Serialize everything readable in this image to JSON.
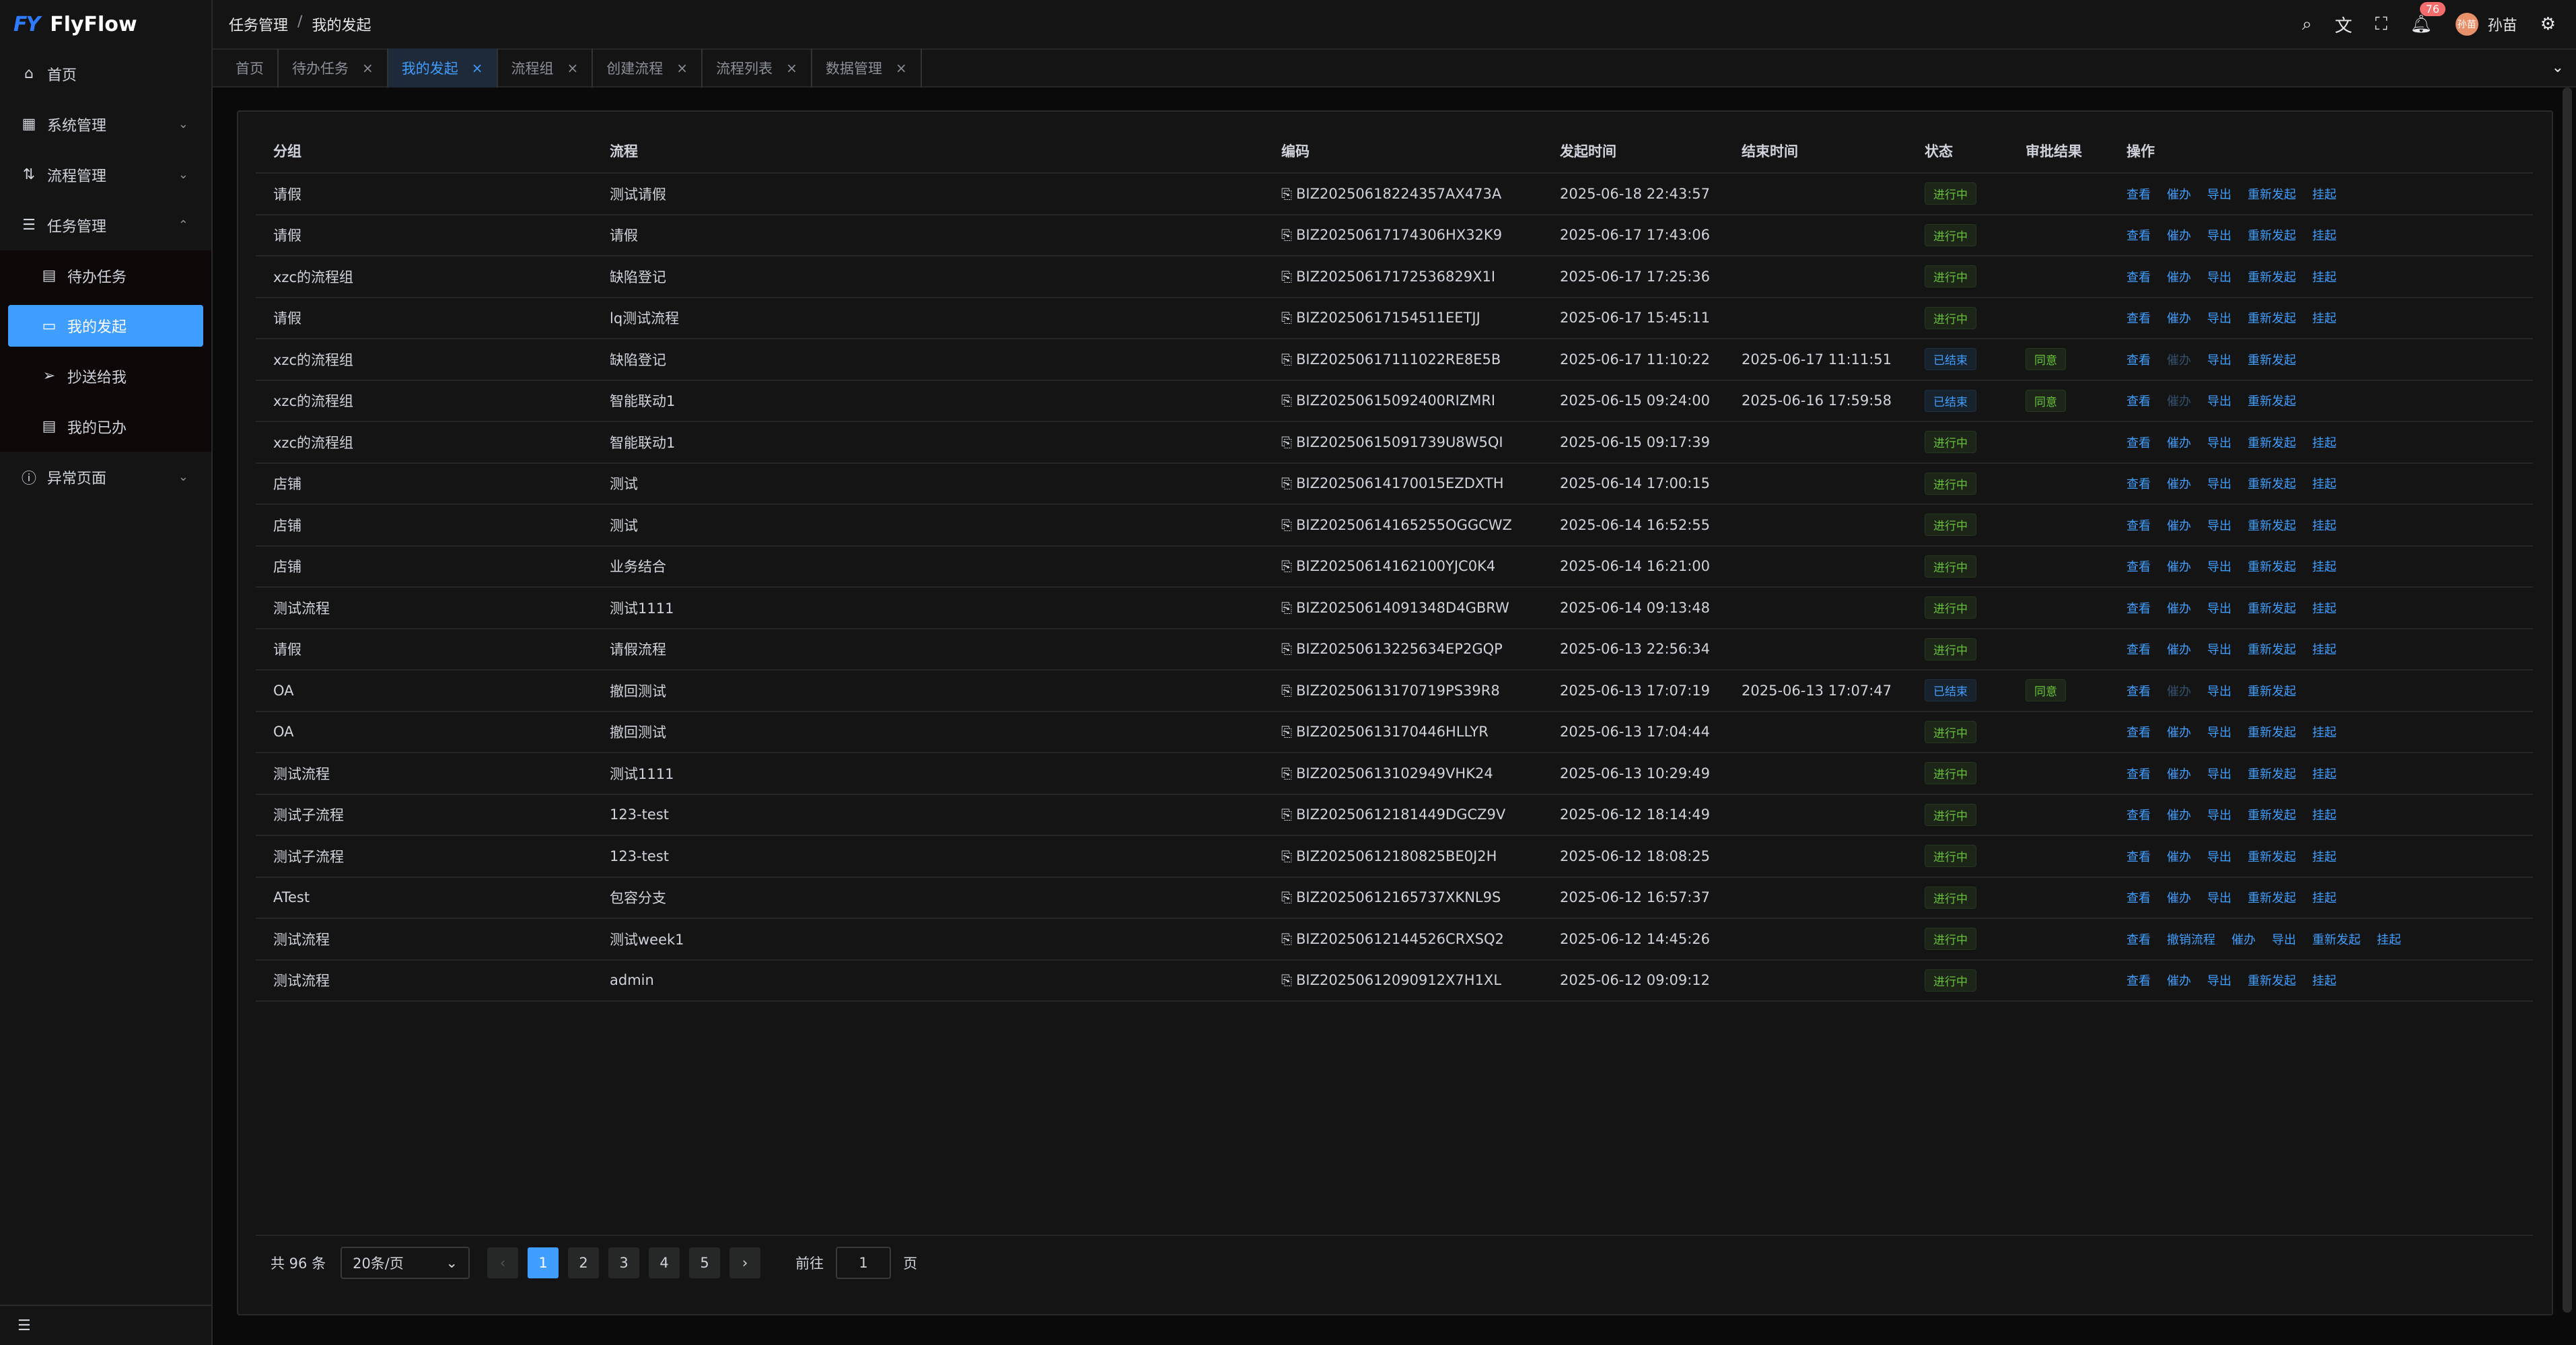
{
  "app": {
    "logo_mark": "FY",
    "name": "FlyFlow"
  },
  "sidebar": {
    "items": [
      {
        "label": "首页"
      },
      {
        "label": "系统管理"
      },
      {
        "label": "流程管理"
      },
      {
        "label": "任务管理"
      },
      {
        "label": "异常页面"
      }
    ],
    "task_sub": [
      {
        "label": "待办任务"
      },
      {
        "label": "我的发起"
      },
      {
        "label": "抄送给我"
      },
      {
        "label": "我的已办"
      }
    ]
  },
  "header": {
    "breadcrumb": [
      "任务管理",
      "我的发起"
    ],
    "notification_count": "76",
    "user_name": "孙苗",
    "avatar_text": "孙苗"
  },
  "tabs": [
    {
      "label": "首页",
      "closable": false
    },
    {
      "label": "待办任务",
      "closable": true
    },
    {
      "label": "我的发起",
      "closable": true,
      "active": true
    },
    {
      "label": "流程组",
      "closable": true
    },
    {
      "label": "创建流程",
      "closable": true
    },
    {
      "label": "流程列表",
      "closable": true
    },
    {
      "label": "数据管理",
      "closable": true
    }
  ],
  "table": {
    "columns": [
      "分组",
      "流程",
      "编码",
      "发起时间",
      "结束时间",
      "状态",
      "审批结果",
      "操作"
    ],
    "rows": [
      {
        "group": "请假",
        "flow": "测试请假",
        "code": "BIZ20250618224357AX473A",
        "start": "2025-06-18 22:43:57",
        "end": "",
        "status": "进行中",
        "result": "",
        "ops": [
          "查看",
          "催办",
          "导出",
          "重新发起",
          "挂起"
        ]
      },
      {
        "group": "请假",
        "flow": "请假",
        "code": "BIZ20250617174306HX32K9",
        "start": "2025-06-17 17:43:06",
        "end": "",
        "status": "进行中",
        "result": "",
        "ops": [
          "查看",
          "催办",
          "导出",
          "重新发起",
          "挂起"
        ]
      },
      {
        "group": "xzc的流程组",
        "flow": "缺陷登记",
        "code": "BIZ20250617172536829X1I",
        "start": "2025-06-17 17:25:36",
        "end": "",
        "status": "进行中",
        "result": "",
        "ops": [
          "查看",
          "催办",
          "导出",
          "重新发起",
          "挂起"
        ]
      },
      {
        "group": "请假",
        "flow": "lq测试流程",
        "code": "BIZ20250617154511EETJJ",
        "start": "2025-06-17 15:45:11",
        "end": "",
        "status": "进行中",
        "result": "",
        "ops": [
          "查看",
          "催办",
          "导出",
          "重新发起",
          "挂起"
        ]
      },
      {
        "group": "xzc的流程组",
        "flow": "缺陷登记",
        "code": "BIZ20250617111022RE8E5B",
        "start": "2025-06-17 11:10:22",
        "end": "2025-06-17 11:11:51",
        "status": "已结束",
        "result": "同意",
        "ops": [
          "查看",
          "催办",
          "导出",
          "重新发起"
        ]
      },
      {
        "group": "xzc的流程组",
        "flow": "智能联动1",
        "code": "BIZ20250615092400RIZMRI",
        "start": "2025-06-15 09:24:00",
        "end": "2025-06-16 17:59:58",
        "status": "已结束",
        "result": "同意",
        "ops": [
          "查看",
          "催办",
          "导出",
          "重新发起"
        ]
      },
      {
        "group": "xzc的流程组",
        "flow": "智能联动1",
        "code": "BIZ20250615091739U8W5QI",
        "start": "2025-06-15 09:17:39",
        "end": "",
        "status": "进行中",
        "result": "",
        "ops": [
          "查看",
          "催办",
          "导出",
          "重新发起",
          "挂起"
        ]
      },
      {
        "group": "店铺",
        "flow": "测试",
        "code": "BIZ20250614170015EZDXTH",
        "start": "2025-06-14 17:00:15",
        "end": "",
        "status": "进行中",
        "result": "",
        "ops": [
          "查看",
          "催办",
          "导出",
          "重新发起",
          "挂起"
        ]
      },
      {
        "group": "店铺",
        "flow": "测试",
        "code": "BIZ20250614165255OGGCWZ",
        "start": "2025-06-14 16:52:55",
        "end": "",
        "status": "进行中",
        "result": "",
        "ops": [
          "查看",
          "催办",
          "导出",
          "重新发起",
          "挂起"
        ]
      },
      {
        "group": "店铺",
        "flow": "业务结合",
        "code": "BIZ20250614162100YJC0K4",
        "start": "2025-06-14 16:21:00",
        "end": "",
        "status": "进行中",
        "result": "",
        "ops": [
          "查看",
          "催办",
          "导出",
          "重新发起",
          "挂起"
        ]
      },
      {
        "group": "测试流程",
        "flow": "测试1111",
        "code": "BIZ20250614091348D4GBRW",
        "start": "2025-06-14 09:13:48",
        "end": "",
        "status": "进行中",
        "result": "",
        "ops": [
          "查看",
          "催办",
          "导出",
          "重新发起",
          "挂起"
        ]
      },
      {
        "group": "请假",
        "flow": "请假流程",
        "code": "BIZ20250613225634EP2GQP",
        "start": "2025-06-13 22:56:34",
        "end": "",
        "status": "进行中",
        "result": "",
        "ops": [
          "查看",
          "催办",
          "导出",
          "重新发起",
          "挂起"
        ]
      },
      {
        "group": "OA",
        "flow": "撤回测试",
        "code": "BIZ20250613170719PS39R8",
        "start": "2025-06-13 17:07:19",
        "end": "2025-06-13 17:07:47",
        "status": "已结束",
        "result": "同意",
        "ops": [
          "查看",
          "催办",
          "导出",
          "重新发起"
        ]
      },
      {
        "group": "OA",
        "flow": "撤回测试",
        "code": "BIZ20250613170446HLLYR",
        "start": "2025-06-13 17:04:44",
        "end": "",
        "status": "进行中",
        "result": "",
        "ops": [
          "查看",
          "催办",
          "导出",
          "重新发起",
          "挂起"
        ]
      },
      {
        "group": "测试流程",
        "flow": "测试1111",
        "code": "BIZ20250613102949VHK24",
        "start": "2025-06-13 10:29:49",
        "end": "",
        "status": "进行中",
        "result": "",
        "ops": [
          "查看",
          "催办",
          "导出",
          "重新发起",
          "挂起"
        ]
      },
      {
        "group": "测试子流程",
        "flow": "123-test",
        "code": "BIZ20250612181449DGCZ9V",
        "start": "2025-06-12 18:14:49",
        "end": "",
        "status": "进行中",
        "result": "",
        "ops": [
          "查看",
          "催办",
          "导出",
          "重新发起",
          "挂起"
        ]
      },
      {
        "group": "测试子流程",
        "flow": "123-test",
        "code": "BIZ20250612180825BE0J2H",
        "start": "2025-06-12 18:08:25",
        "end": "",
        "status": "进行中",
        "result": "",
        "ops": [
          "查看",
          "催办",
          "导出",
          "重新发起",
          "挂起"
        ]
      },
      {
        "group": "ATest",
        "flow": "包容分支",
        "code": "BIZ20250612165737XKNL9S",
        "start": "2025-06-12 16:57:37",
        "end": "",
        "status": "进行中",
        "result": "",
        "ops": [
          "查看",
          "催办",
          "导出",
          "重新发起",
          "挂起"
        ]
      },
      {
        "group": "测试流程",
        "flow": "测试week1",
        "code": "BIZ20250612144526CRXSQ2",
        "start": "2025-06-12 14:45:26",
        "end": "",
        "status": "进行中",
        "result": "",
        "ops": [
          "查看",
          "撤销流程",
          "催办",
          "导出",
          "重新发起",
          "挂起"
        ]
      },
      {
        "group": "测试流程",
        "flow": "admin",
        "code": "BIZ20250612090912X7H1XL",
        "start": "2025-06-12 09:09:12",
        "end": "",
        "status": "进行中",
        "result": "",
        "ops": [
          "查看",
          "催办",
          "导出",
          "重新发起",
          "挂起"
        ]
      }
    ]
  },
  "pager": {
    "total": "共 96 条",
    "page_size": "20条/页",
    "pages": [
      "1",
      "2",
      "3",
      "4",
      "5"
    ],
    "current": "1",
    "goto_label": "前往",
    "goto_value": "1",
    "page_unit": "页"
  }
}
